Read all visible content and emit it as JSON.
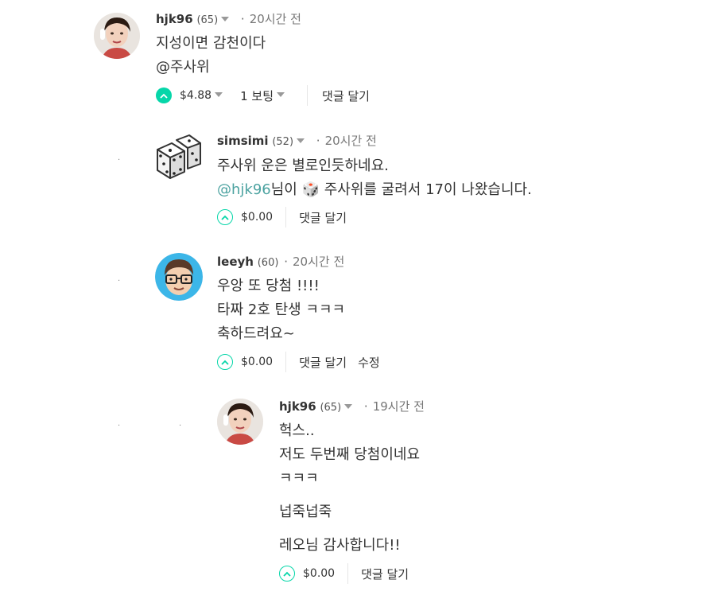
{
  "comments": [
    {
      "author": "hjk96",
      "reputation": "(65)",
      "time": "20시간 전",
      "lines": [
        "지성이면 감천이다",
        "@주사위"
      ],
      "payout": "$4.88",
      "votes": "1 보팅",
      "reply_label": "댓글 달기",
      "avatar": "audrey-avatar"
    },
    {
      "author": "simsimi",
      "reputation": "(52)",
      "time": "20시간 전",
      "line1": "주사위 운은 별로인듯하네요.",
      "mention": "@hjk96",
      "line2_after": "님이 🎲 주사위를 굴려서 17이 나왔습니다.",
      "payout": "$0.00",
      "reply_label": "댓글 달기",
      "avatar": "dice-avatar"
    },
    {
      "author": "leeyh",
      "reputation": "(60)",
      "time": "20시간 전",
      "lines": [
        "우앙 또 당첨 !!!!",
        "타짜 2호 탄생 ㅋㅋㅋ",
        "축하드려요~"
      ],
      "payout": "$0.00",
      "reply_label": "댓글 달기",
      "edit_label": "수정",
      "avatar": "glasses-avatar"
    },
    {
      "author": "hjk96",
      "reputation": "(65)",
      "time": "19시간 전",
      "lines": [
        "헉스..",
        "저도 두번째 당첨이네요",
        "ㅋㅋㅋ",
        "넙죽넙죽",
        "레오님 감사합니다!!"
      ],
      "payout": "$0.00",
      "reply_label": "댓글 달기",
      "avatar": "audrey-avatar"
    }
  ],
  "separator": "·",
  "colors": {
    "accent": "#06d6a9",
    "mention": "#4ba2a0",
    "text": "#333333"
  }
}
